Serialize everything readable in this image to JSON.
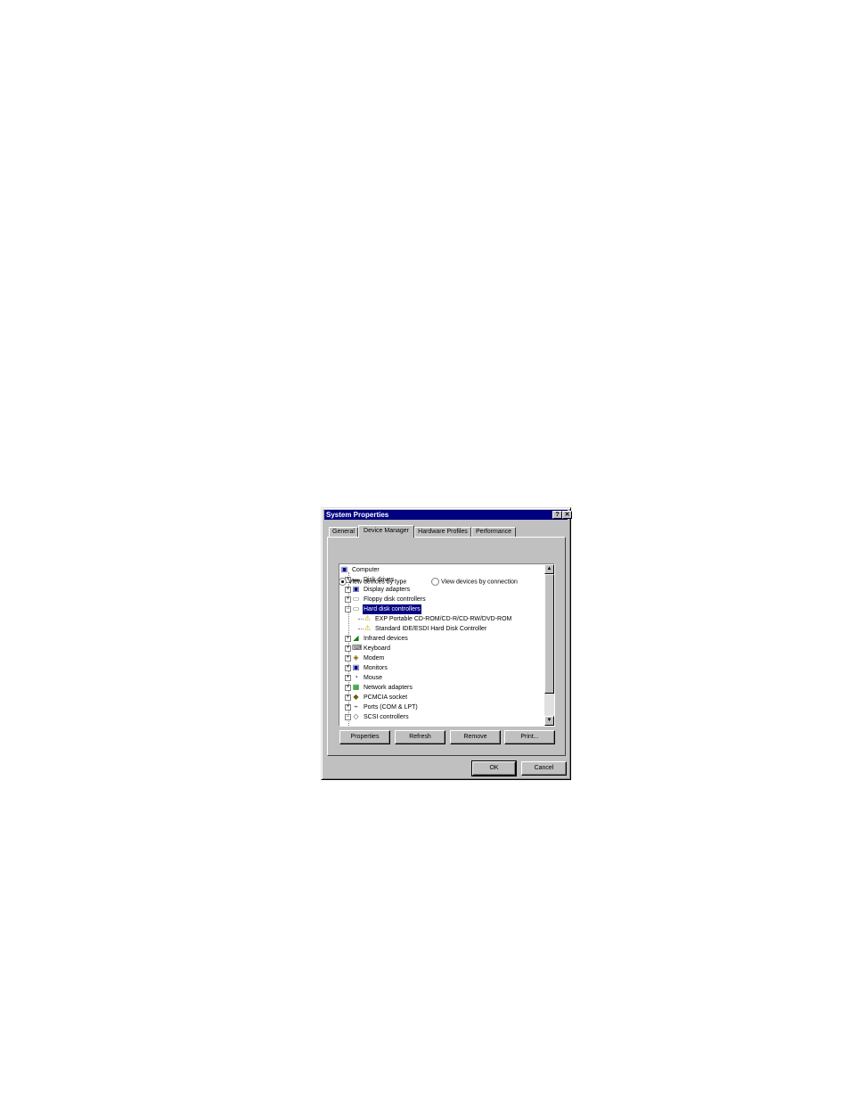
{
  "window": {
    "title": "System Properties",
    "help_glyph": "?",
    "close_glyph": "✕"
  },
  "tabs": [
    {
      "label": "General",
      "active": false
    },
    {
      "label": "Device Manager",
      "active": true
    },
    {
      "label": "Hardware Profiles",
      "active": false
    },
    {
      "label": "Performance",
      "active": false
    }
  ],
  "view_options": [
    {
      "label": "View devices by type",
      "selected": true
    },
    {
      "label": "View devices by connection",
      "selected": false
    }
  ],
  "tree": [
    {
      "label": "Computer",
      "level": 0,
      "icon": "computer-icon",
      "glyph": "▣",
      "color": "#000080",
      "expander": "none",
      "selected": false
    },
    {
      "label": "Disk drives",
      "level": 1,
      "icon": "disk-drive-icon",
      "glyph": "▬",
      "color": "#606060",
      "expander": "+",
      "selected": false
    },
    {
      "label": "Display adapters",
      "level": 1,
      "icon": "display-adapter-icon",
      "glyph": "▣",
      "color": "#000080",
      "expander": "+",
      "selected": false
    },
    {
      "label": "Floppy disk controllers",
      "level": 1,
      "icon": "floppy-controller-icon",
      "glyph": "▭",
      "color": "#606060",
      "expander": "+",
      "selected": false
    },
    {
      "label": "Hard disk controllers",
      "level": 1,
      "icon": "hard-disk-controller-icon",
      "glyph": "▭",
      "color": "#606060",
      "expander": "−",
      "selected": true
    },
    {
      "label": "EXP Portable CD-ROM/CD-R/CD-RW/DVD-ROM",
      "level": 2,
      "icon": "warning-icon",
      "glyph": "⚠",
      "color": "#c8a000",
      "expander": "none",
      "selected": false
    },
    {
      "label": "Standard IDE/ESDI Hard Disk Controller",
      "level": 2,
      "icon": "warning-icon",
      "glyph": "⚠",
      "color": "#c8a000",
      "expander": "none",
      "selected": false
    },
    {
      "label": "Infrared devices",
      "level": 1,
      "icon": "infrared-icon",
      "glyph": "◢",
      "color": "#008000",
      "expander": "+",
      "selected": false
    },
    {
      "label": "Keyboard",
      "level": 1,
      "icon": "keyboard-icon",
      "glyph": "⌨",
      "color": "#404040",
      "expander": "+",
      "selected": false
    },
    {
      "label": "Modem",
      "level": 1,
      "icon": "modem-icon",
      "glyph": "◈",
      "color": "#806000",
      "expander": "+",
      "selected": false
    },
    {
      "label": "Monitors",
      "level": 1,
      "icon": "monitor-icon",
      "glyph": "▣",
      "color": "#000080",
      "expander": "+",
      "selected": false
    },
    {
      "label": "Mouse",
      "level": 1,
      "icon": "mouse-icon",
      "glyph": "◔",
      "color": "#404040",
      "expander": "+",
      "selected": false
    },
    {
      "label": "Network adapters",
      "level": 1,
      "icon": "network-adapter-icon",
      "glyph": "▦",
      "color": "#008000",
      "expander": "+",
      "selected": false
    },
    {
      "label": "PCMCIA socket",
      "level": 1,
      "icon": "pcmcia-icon",
      "glyph": "◆",
      "color": "#606000",
      "expander": "+",
      "selected": false
    },
    {
      "label": "Ports (COM & LPT)",
      "level": 1,
      "icon": "port-icon",
      "glyph": "⌁",
      "color": "#404040",
      "expander": "+",
      "selected": false
    },
    {
      "label": "SCSI controllers",
      "level": 1,
      "icon": "scsi-controller-icon",
      "glyph": "◇",
      "color": "#404040",
      "expander": "−",
      "selected": false
    }
  ],
  "action_buttons": [
    "Properties",
    "Refresh",
    "Remove",
    "Print..."
  ],
  "footer_buttons": [
    "OK",
    "Cancel"
  ]
}
